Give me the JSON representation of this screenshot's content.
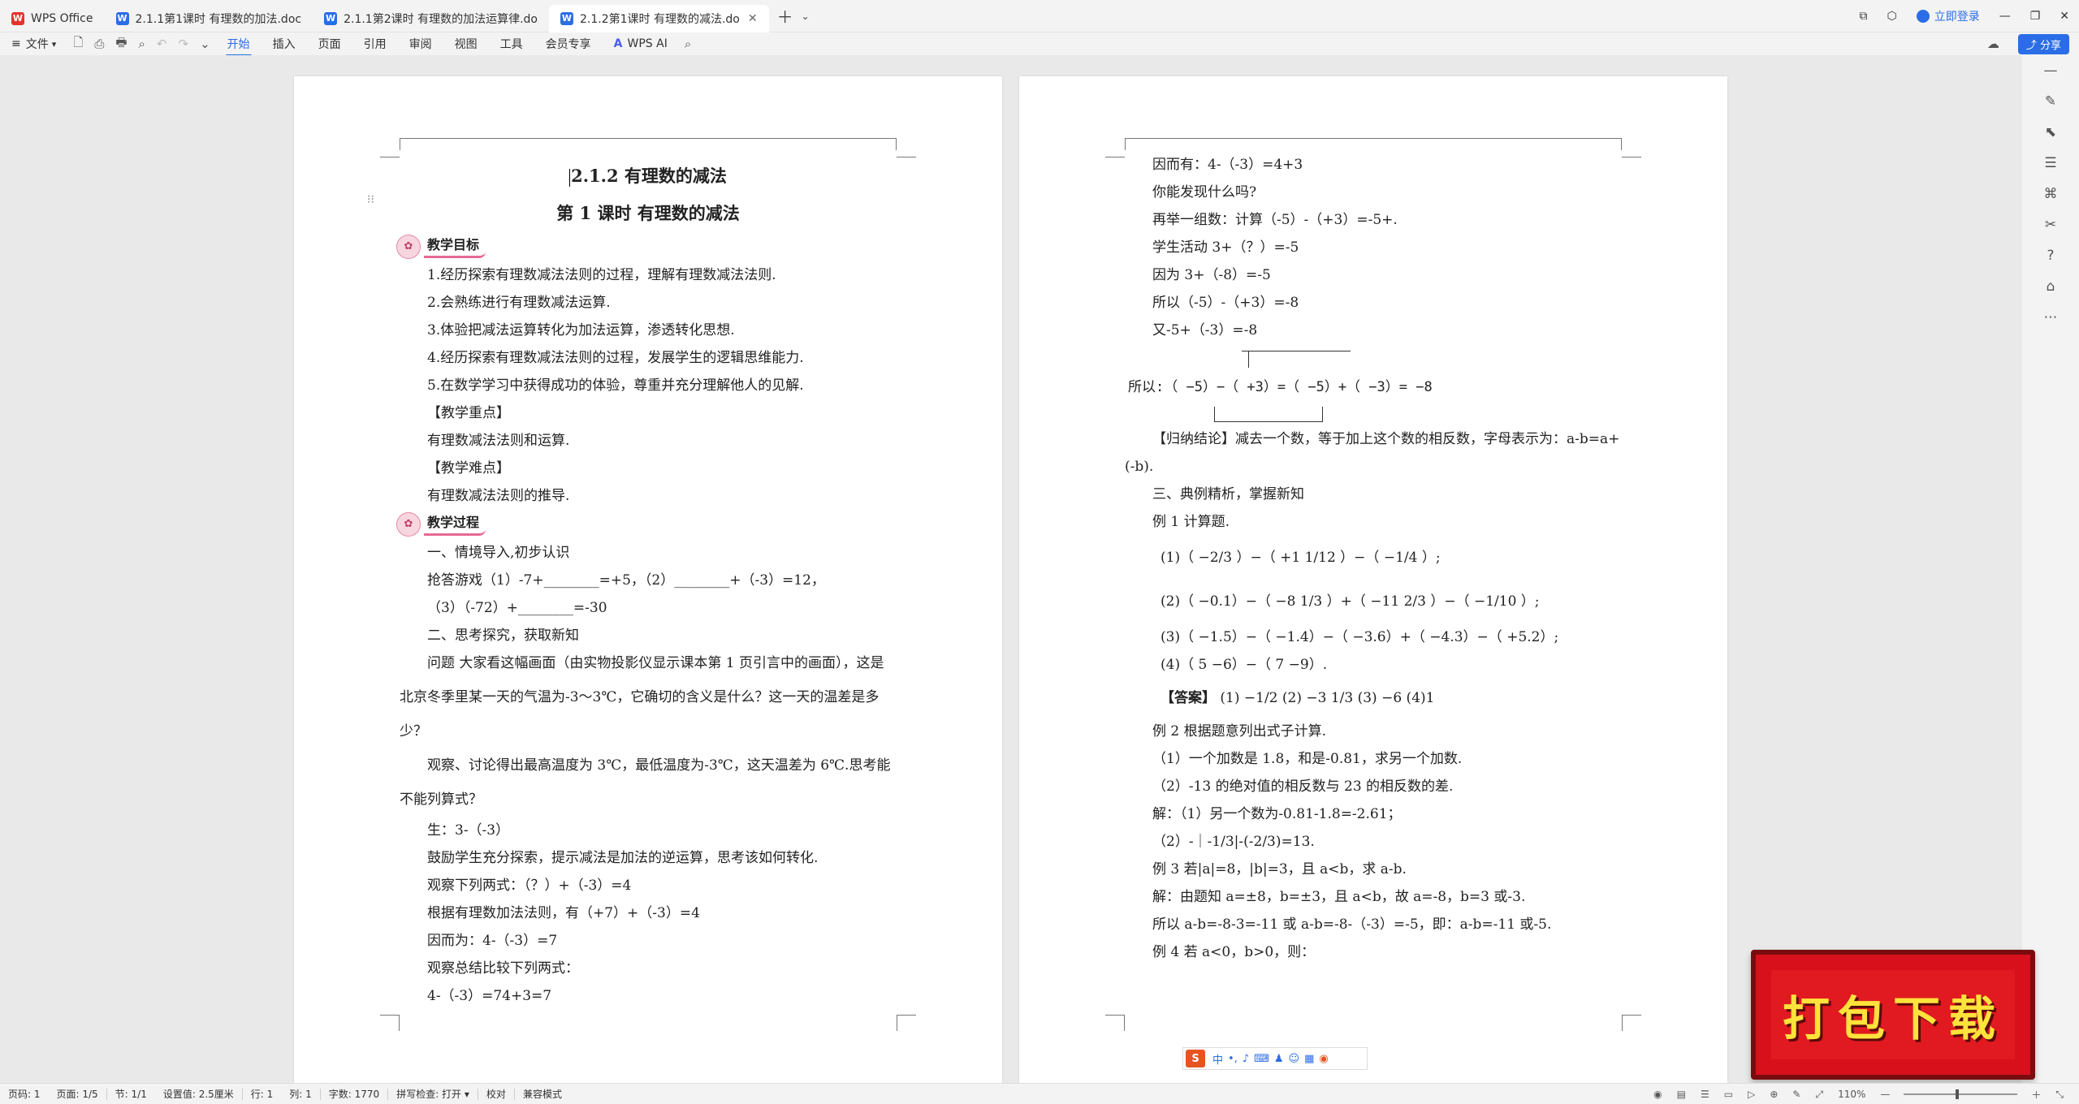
{
  "tabs": [
    {
      "label": "WPS Office",
      "icon": "W"
    },
    {
      "label": "2.1.1第1课时 有理数的加法.doc",
      "icon": "W"
    },
    {
      "label": "2.1.1第2课时 有理数的加法运算律.do",
      "icon": "W"
    },
    {
      "label": "2.1.2第1课时 有理数的减法.do",
      "icon": "W"
    }
  ],
  "titlebar": {
    "login_label": "立即登录"
  },
  "ribbon": {
    "file_label": "文件",
    "menus": [
      "开始",
      "插入",
      "页面",
      "引用",
      "审阅",
      "视图",
      "工具",
      "会员专享"
    ],
    "ai_label": "WPS AI",
    "share_label": "分享"
  },
  "page1": {
    "title": "2.1.2  有理数的减法",
    "subtitle": "第 1 课时  有理数的减法",
    "sec1": "教学目标",
    "goals": [
      "1.经历探索有理数减法法则的过程，理解有理数减法法则.",
      "2.会熟练进行有理数减法运算.",
      "3.体验把减法运算转化为加法运算，渗透转化思想.",
      "4.经历探索有理数减法法则的过程，发展学生的逻辑思维能力.",
      "5.在数学学习中获得成功的体验，尊重并充分理解他人的见解."
    ],
    "key_head": "【教学重点】",
    "key_text": "有理数减法法则和运算.",
    "diff_head": "【教学难点】",
    "diff_text": "有理数减法法则的推导.",
    "sec2": "教学过程",
    "l1": "一、情境导入,初步认识",
    "l2": "抢答游戏（1）-7+________=+5，（2）________+（-3）=12，",
    "l3": "（3）（-72）+________=-30",
    "l4": "二、思考探究，获取新知",
    "p1": "问题  大家看这幅画面（由实物投影仪显示课本第 1 页引言中的画面），这是北京冬季里某一天的气温为-3～3℃，它确切的含义是什么？这一天的温差是多少？",
    "p2": "观察、讨论得出最高温度为 3℃，最低温度为-3℃，这天温差为 6℃.思考能不能列算式？",
    "l5": "生：3-（-3）",
    "l6": "鼓励学生充分探索，提示减法是加法的逆运算，思考该如何转化.",
    "l7": "观察下列两式：（？）+（-3）=4",
    "l8": "根据有理数加法法则，有（+7）+（-3）=4",
    "l9": "因而为：4-（-3）=7",
    "l10": "观察总结比较下列两式：",
    "l11": "4-（-3）=74+3=7"
  },
  "page2": {
    "l1": "因而有：4-（-3）=4+3",
    "l2": "你能发现什么吗?",
    "l3": "再举一组数：计算（-5）-（+3）=-5+.",
    "l4": "学生活动 3+（？）=-5",
    "l5": "因为 3+（-8）=-5",
    "l6": "所以（-5）-（+3）=-8",
    "l7": "又-5+（-3）=-8",
    "formula": "所以:（ −5）−（ +3）=（ −5）+（ −3）= −8",
    "conclusion": "【归纳结论】减去一个数，等于加上这个数的相反数，字母表示为：a-b=a+(-b).",
    "l8": "三、典例精析，掌握新知",
    "l9": "例 1 计算题.",
    "ex1": "(1)（ −2/3 ）−（ +1 1/12 ）−（ −1/4 ）;",
    "ex2": "(2)（ −0.1）−（ −8 1/3 ）+（ −11 2/3 ）−（ −1/10 ）;",
    "ex3": "(3)（ −1.5）−（ −1.4）−（ −3.6）+（ −4.3）−（ +5.2）;",
    "ex4": "(4)（ 5 −6）−（ 7 −9）.",
    "ans_head": "【答案】",
    "ans_text": "(1) −1/2   (2) −3 1/3   (3) −6   (4)1",
    "l10": "例 2  根据题意列出式子计算.",
    "l11": "（1）一个加数是 1.8，和是-0.81，求另一个加数.",
    "l12": "（2）-13 的绝对值的相反数与 23 的相反数的差.",
    "l13": "解：（1）另一个数为-0.81-1.8=-2.61；",
    "l14": "（2）-｜-1/3|-(-2/3)=13.",
    "l15": "例 3 若|a|=8，|b|=3，且 a<b，求 a-b.",
    "l16": "解：由题知 a=±8，b=±3，且 a<b，故 a=-8，b=3 或-3.",
    "l17": "所以 a-b=-8-3=-11 或 a-b=-8-（-3）=-5，即：a-b=-11 或-5.",
    "l18": "例 4 若 a<0，b>0，则："
  },
  "ime": {
    "logo": "S",
    "mode": "中"
  },
  "promo": {
    "text": "打包下载"
  },
  "status": {
    "page_num": "页码: 1",
    "pages": "页面: 1/5",
    "section": "节: 1/1",
    "setting": "设置值: 2.5厘米",
    "row": "行: 1",
    "col": "列: 1",
    "words": "字数: 1770",
    "spell": "拼写检查: 打开",
    "proof": "校对",
    "compat": "兼容模式",
    "zoom": "110%"
  }
}
